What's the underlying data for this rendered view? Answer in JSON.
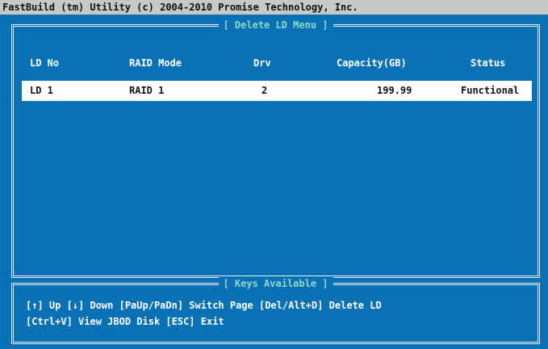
{
  "title_bar": "FastBuild (tm) Utility (c) 2004-2010 Promise Technology, Inc.",
  "main_panel": {
    "title": "[ Delete LD Menu ]",
    "columns": [
      "LD No",
      "RAID Mode",
      "Drv",
      "Capacity(GB)",
      "Status"
    ],
    "rows": [
      [
        "LD  1",
        "RAID 1",
        "2",
        "199.99",
        "Functional"
      ]
    ]
  },
  "keys_panel": {
    "title": "[ Keys Available ]",
    "line1": "[↑] Up [↓] Down [PaUp/PaDn] Switch Page [Del/Alt+D] Delete LD",
    "line2": "[Ctrl+V] View JBOD Disk  [ESC] Exit"
  },
  "colors": {
    "background": "#0a72b4",
    "frame_title": "#8fd6c8",
    "title_bar": "#c8c8c8"
  }
}
